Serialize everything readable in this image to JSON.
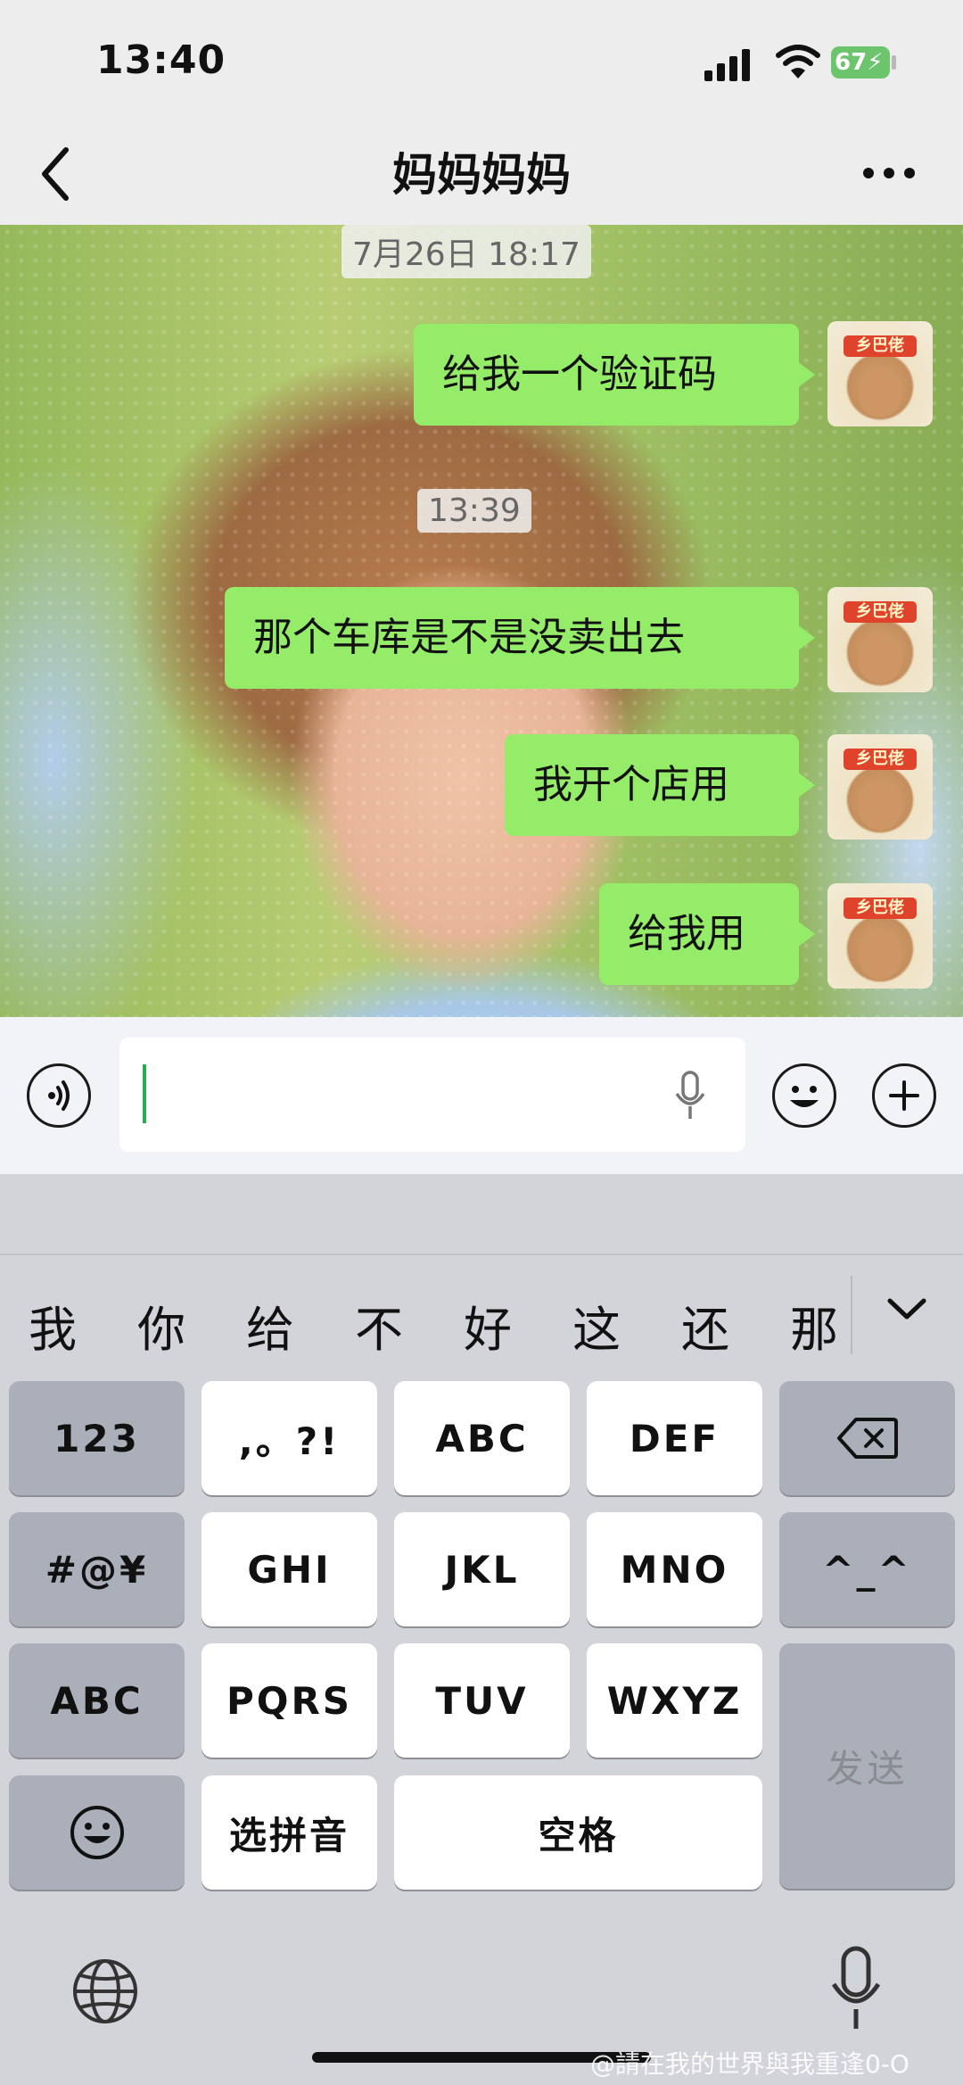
{
  "status_bar": {
    "time": "13:40",
    "battery_level": "67",
    "battery_charging": true
  },
  "nav": {
    "title": "妈妈妈妈",
    "back_icon": "chevron-left-icon",
    "more_icon": "ellipsis-icon"
  },
  "chat": {
    "timestamps": [
      "7月26日 18:17",
      "13:39"
    ],
    "messages": [
      {
        "text": "给我一个验证码",
        "sender": "self"
      },
      {
        "text": "那个车库是不是没卖出去",
        "sender": "self"
      },
      {
        "text": "我开个店用",
        "sender": "self"
      },
      {
        "text": "给我用",
        "sender": "self"
      }
    ],
    "avatar_label": "乡巴佬",
    "bubble_color": "#95ec69"
  },
  "input_bar": {
    "value": "",
    "voice_icon": "voice-icon",
    "mic_icon": "microphone-icon",
    "emoji_icon": "emoji-icon",
    "plus_icon": "plus-icon"
  },
  "keyboard": {
    "candidates": [
      "我",
      "你",
      "给",
      "不",
      "好",
      "这",
      "还",
      "那"
    ],
    "rows": [
      [
        "123",
        ",。?!",
        "ABC",
        "DEF"
      ],
      [
        "#@¥",
        "GHI",
        "JKL",
        "MNO",
        "^_^"
      ],
      [
        "ABC",
        "PQRS",
        "TUV",
        "WXYZ"
      ],
      [
        "选拼音",
        "空格"
      ]
    ],
    "send_label": "发送"
  },
  "watermark": "@請在我的世界與我重逢0-O"
}
